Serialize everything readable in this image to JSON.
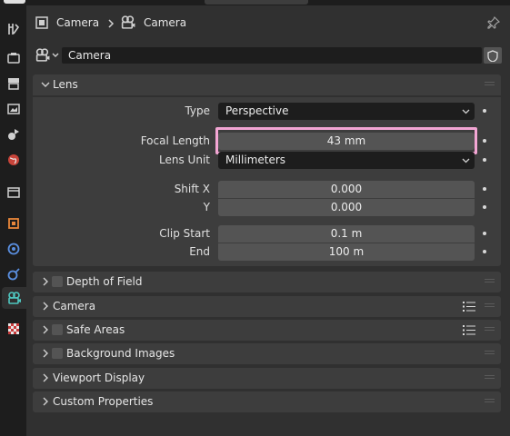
{
  "colors": {
    "background": "#303030",
    "panel": "#3d3d3d",
    "tabbar": "#1d1d1d",
    "field": "#545454",
    "highlight": "#f3a6d4",
    "active_tab_icon": "#4fc7c0"
  },
  "header": {
    "crumb1": "Camera",
    "crumb2": "Camera",
    "crumb1_icon": "scene-object-icon",
    "crumb2_icon": "camera-data-icon",
    "pin_icon": "pin-icon"
  },
  "datablock": {
    "name": "Camera",
    "type_icon": "camera-data-icon",
    "fake_user_icon": "shield-icon"
  },
  "lens": {
    "title": "Lens",
    "type_label": "Type",
    "type_value": "Perspective",
    "focal_label": "Focal Length",
    "focal_value": "43 mm",
    "unit_label": "Lens Unit",
    "unit_value": "Millimeters",
    "shiftx_label": "Shift X",
    "shiftx_value": "0.000",
    "shifty_label": "Y",
    "shifty_value": "0.000",
    "clipstart_label": "Clip Start",
    "clipstart_value": "0.1 m",
    "clipend_label": "End",
    "clipend_value": "100 m"
  },
  "panels": {
    "dof": "Depth of Field",
    "camera": "Camera",
    "safe": "Safe Areas",
    "bg": "Background Images",
    "viewport": "Viewport Display",
    "custom": "Custom Properties"
  },
  "tabs": [
    "tool-icon",
    "render-icon",
    "output-icon",
    "view-layer-icon",
    "scene-icon",
    "world-icon",
    "collection-icon",
    "object-icon",
    "physics-icon",
    "constraints-icon",
    "camera-data-icon",
    "texture-icon"
  ]
}
